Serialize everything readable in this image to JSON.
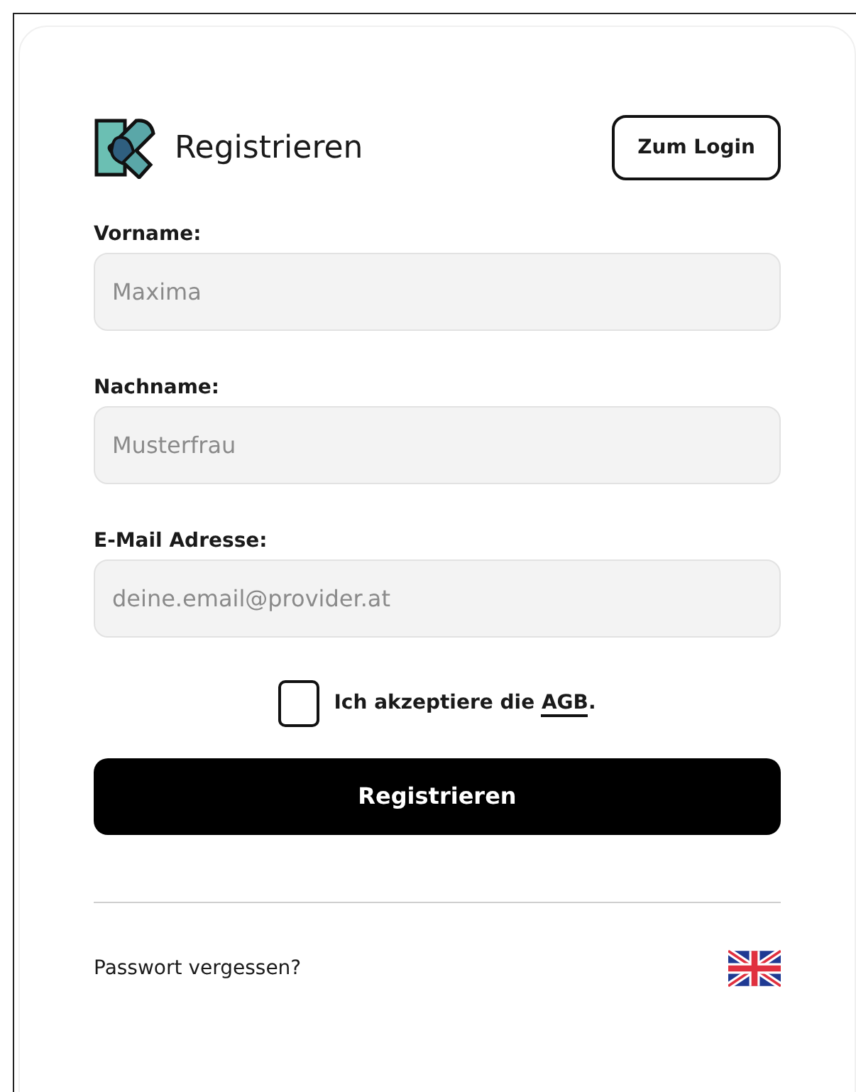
{
  "header": {
    "title": "Registrieren",
    "login_button": "Zum Login"
  },
  "fields": [
    {
      "label": "Vorname:",
      "placeholder": "Maxima"
    },
    {
      "label": "Nachname:",
      "placeholder": "Musterfrau"
    },
    {
      "label": "E-Mail Adresse:",
      "placeholder": "deine.email@provider.at"
    }
  ],
  "terms": {
    "checked": false,
    "text": "Ich akzeptiere die",
    "link": "AGB",
    "suffix": "."
  },
  "submit_button": "Registrieren",
  "footer": {
    "forgot_link": "Passwort vergessen?"
  }
}
